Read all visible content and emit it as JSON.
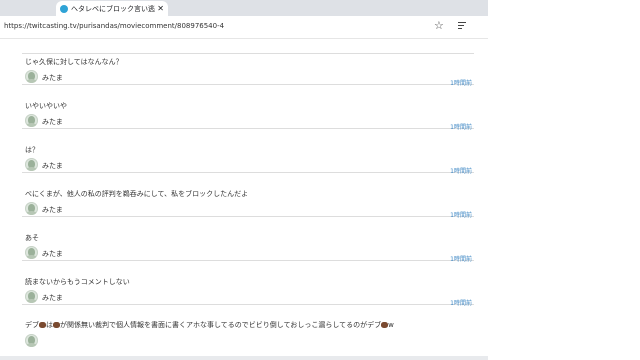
{
  "tab": {
    "title": "へタレベにブロック言い逃げｗ コメント"
  },
  "address": {
    "url": "https://twitcasting.tv/purisandas/moviecomment/808976540-4"
  },
  "comments": [
    {
      "text": "じゃ久保に対してはなんなん？",
      "user": "みたま",
      "time": "1時間前"
    },
    {
      "text": "いやいやいや",
      "user": "みたま",
      "time": "1時間前"
    },
    {
      "text": "は？",
      "user": "みたま",
      "time": "1時間前"
    },
    {
      "text": "べにくまが、他人の私の評判を鵜呑みにして、私をブロックしたんだよ",
      "user": "みたま",
      "time": "1時間前"
    },
    {
      "text": "あそ",
      "user": "みたま",
      "time": "1時間前"
    },
    {
      "text": "読まないからもうコメントしない",
      "user": "みたま",
      "time": "1時間前"
    }
  ],
  "partial": {
    "text_a": "デブ",
    "text_b": "は",
    "text_c": "が関係無い裁判で個人情報を書面に書くアホな事してるのでビビり倒しておしっこ漏らしてるのがデブ",
    "text_d": "w"
  },
  "icons": [
    "favicon-icon",
    "close-icon",
    "star-icon",
    "queue-icon",
    "avatar-icon",
    "bear-emoji-icon"
  ],
  "colors": {
    "link": "#3f88c5",
    "favicon": "#2fa3d6",
    "divider": "#dddddd"
  }
}
